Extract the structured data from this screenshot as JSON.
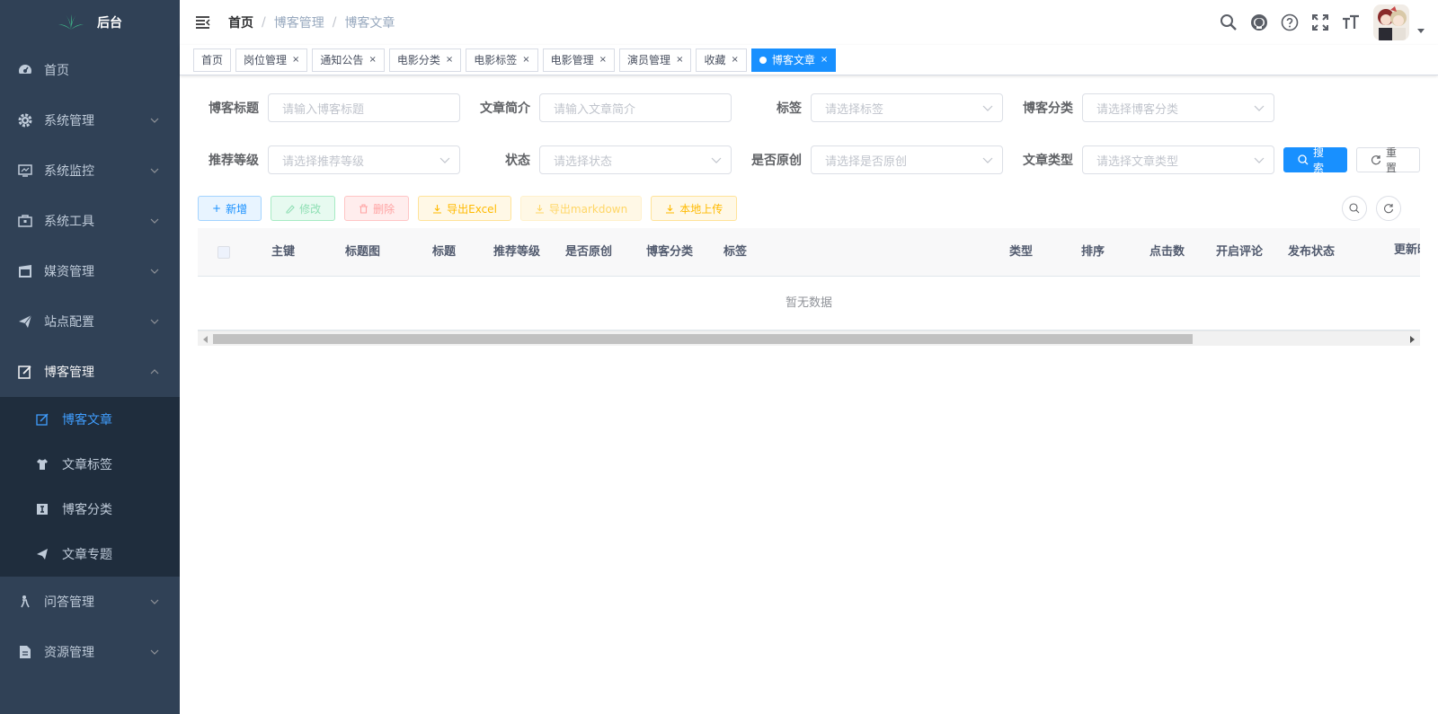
{
  "app": {
    "title": "后台"
  },
  "colors": {
    "sidebar_bg": "#304156",
    "submenu_bg": "#1f2d3d",
    "primary": "#1890ff",
    "active_menu": "#409eff"
  },
  "sidebar": {
    "items": [
      {
        "label": "首页",
        "icon": "dashboard-icon"
      },
      {
        "label": "系统管理",
        "icon": "gear-icon"
      },
      {
        "label": "系统监控",
        "icon": "monitor-icon"
      },
      {
        "label": "系统工具",
        "icon": "toolbox-icon"
      },
      {
        "label": "媒资管理",
        "icon": "film-icon"
      },
      {
        "label": "站点配置",
        "icon": "send-icon"
      },
      {
        "label": "博客管理",
        "icon": "edit-icon"
      },
      {
        "label": "问答管理",
        "icon": "person-icon"
      },
      {
        "label": "资源管理",
        "icon": "document-icon"
      }
    ],
    "blog_sub": [
      {
        "label": "博客文章",
        "icon": "edit-icon"
      },
      {
        "label": "文章标签",
        "icon": "tshirt-icon"
      },
      {
        "label": "博客分类",
        "icon": "text-icon"
      },
      {
        "label": "文章专题",
        "icon": "send-icon"
      }
    ]
  },
  "breadcrumb": [
    "首页",
    "博客管理",
    "博客文章"
  ],
  "tags": [
    "首页",
    "岗位管理",
    "通知公告",
    "电影分类",
    "电影标签",
    "电影管理",
    "演员管理",
    "收藏",
    "博客文章"
  ],
  "tag_close": "×",
  "form": {
    "blog_title": {
      "label": "博客标题",
      "placeholder": "请输入博客标题"
    },
    "summary": {
      "label": "文章简介",
      "placeholder": "请输入文章简介"
    },
    "tag": {
      "label": "标签",
      "placeholder": "请选择标签"
    },
    "category": {
      "label": "博客分类",
      "placeholder": "请选择博客分类"
    },
    "level": {
      "label": "推荐等级",
      "placeholder": "请选择推荐等级"
    },
    "status": {
      "label": "状态",
      "placeholder": "请选择状态"
    },
    "original": {
      "label": "是否原创",
      "placeholder": "请选择是否原创"
    },
    "type": {
      "label": "文章类型",
      "placeholder": "请选择文章类型"
    },
    "search": "搜索",
    "reset": "重置"
  },
  "toolbar": {
    "add": "新增",
    "edit": "修改",
    "delete": "删除",
    "export_excel": "导出Excel",
    "export_md": "导出markdown",
    "upload": "本地上传"
  },
  "table": {
    "columns": [
      "主键",
      "标题图",
      "标题",
      "推荐等级",
      "是否原创",
      "博客分类",
      "标签",
      "类型",
      "排序",
      "点击数",
      "开启评论",
      "发布状态",
      "更新时"
    ],
    "empty_text": "暂无数据"
  }
}
